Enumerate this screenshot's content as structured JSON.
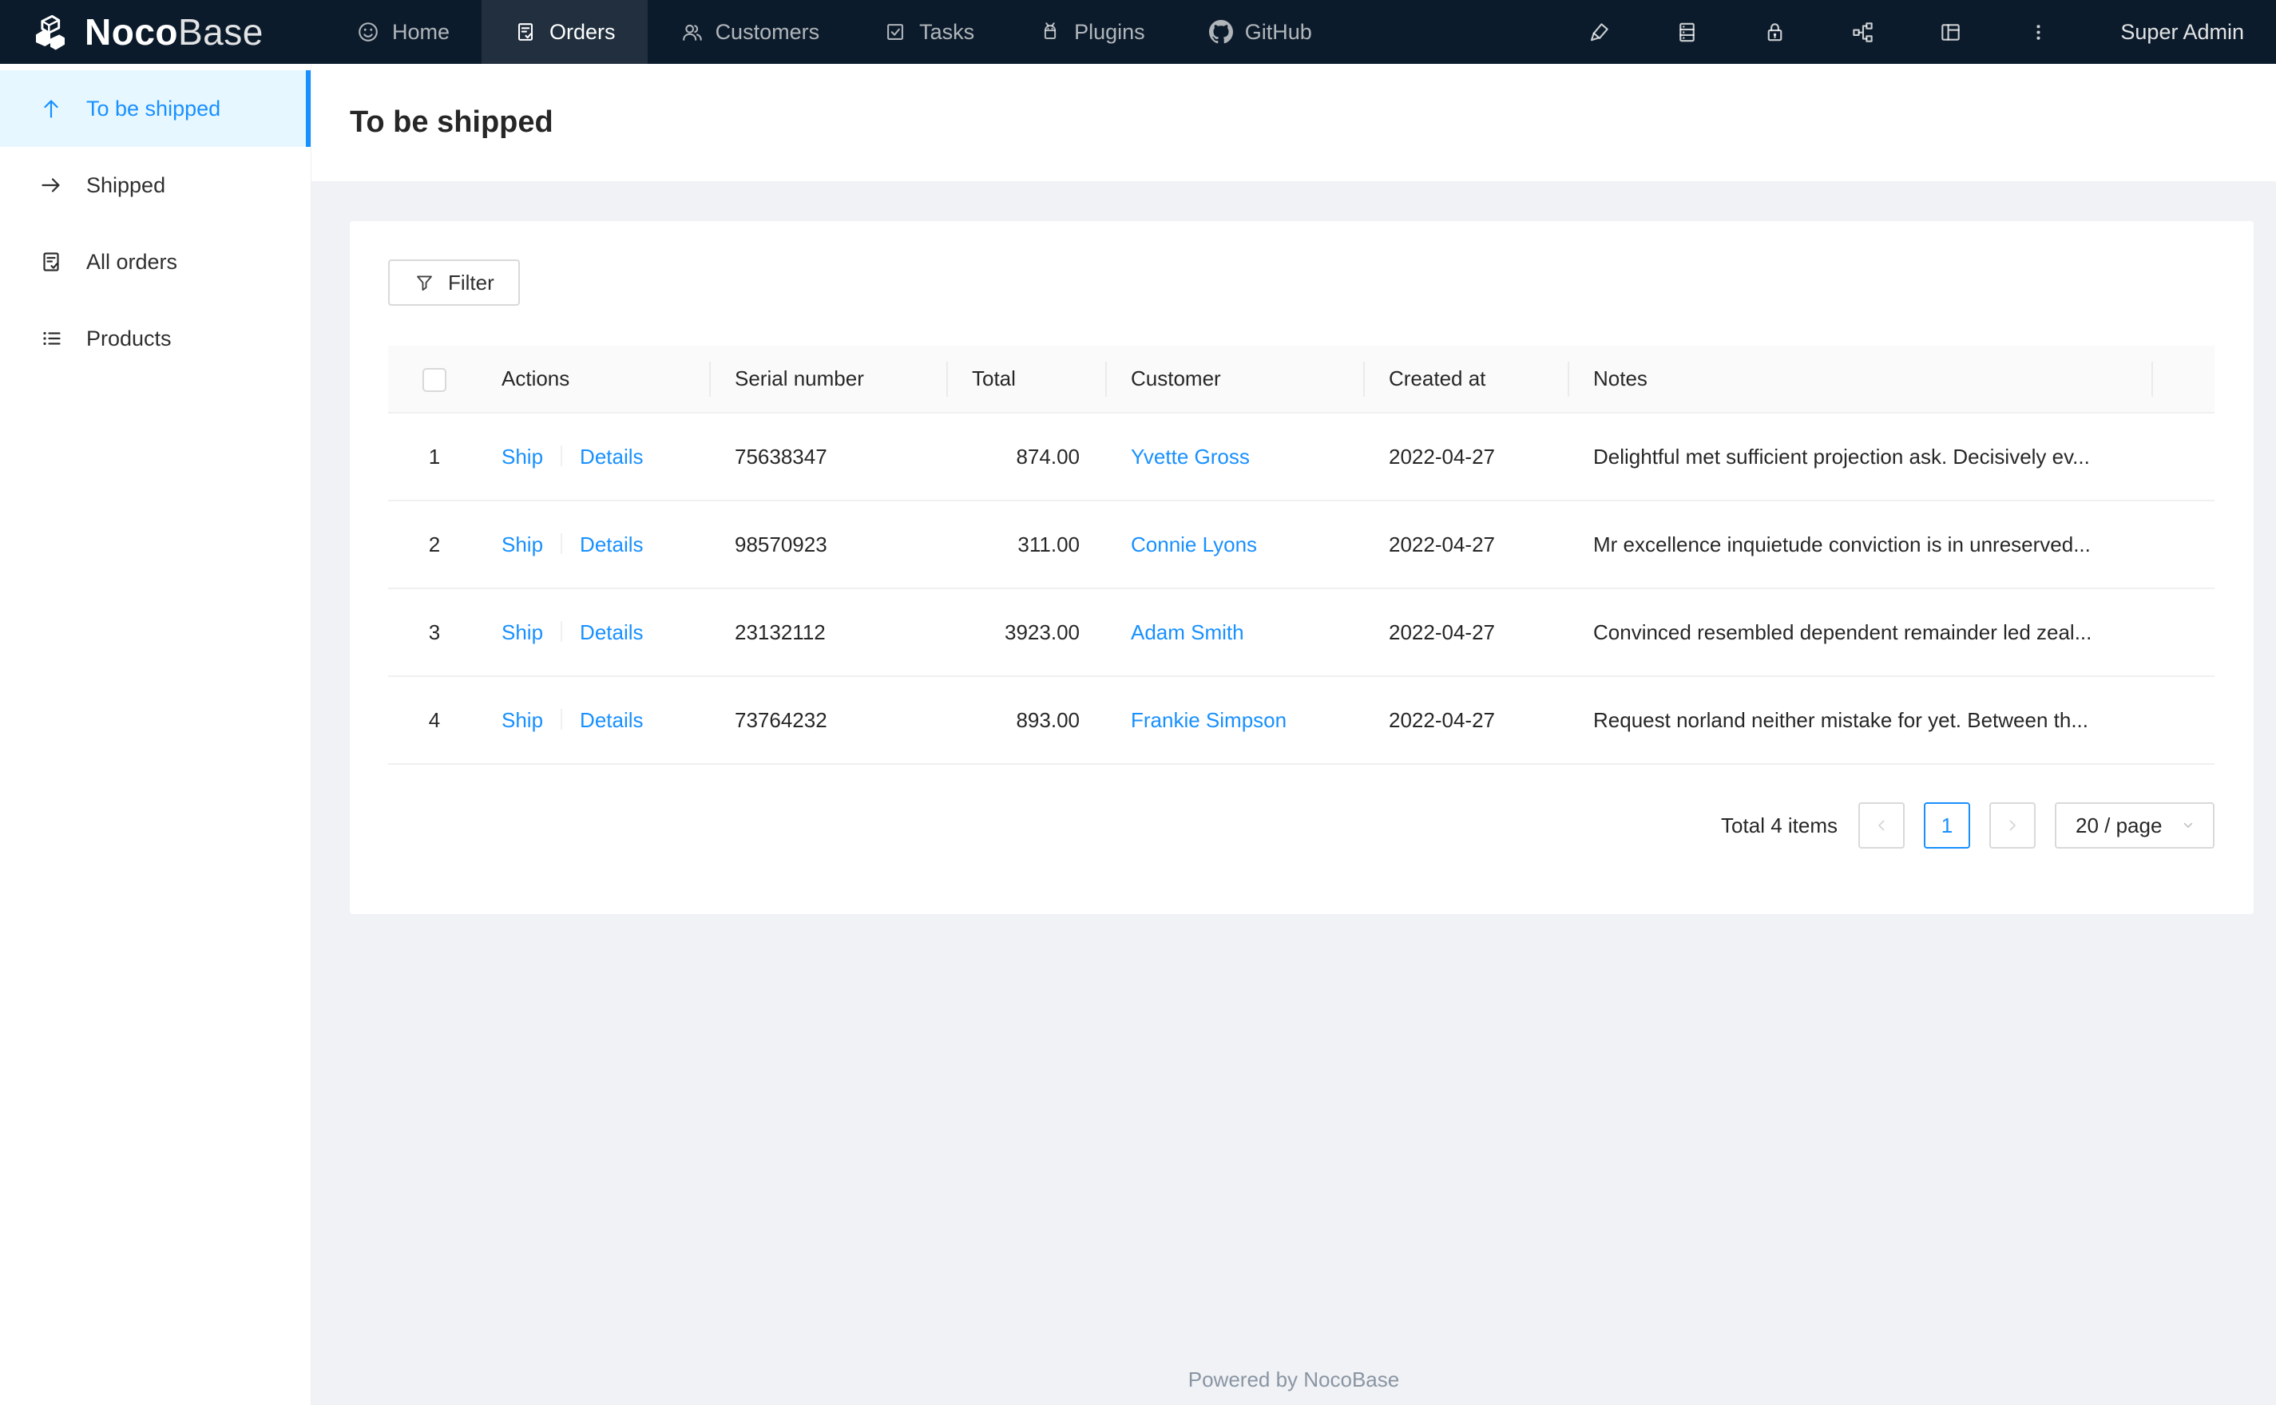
{
  "navbar": {
    "brand": {
      "prefix": "Noco",
      "suffix": "Base"
    },
    "items": [
      {
        "label": "Home",
        "icon": "smile-icon",
        "active": false
      },
      {
        "label": "Orders",
        "icon": "file-done-icon",
        "active": true
      },
      {
        "label": "Customers",
        "icon": "team-icon",
        "active": false
      },
      {
        "label": "Tasks",
        "icon": "check-square-icon",
        "active": false
      },
      {
        "label": "Plugins",
        "icon": "android-icon",
        "active": false
      },
      {
        "label": "GitHub",
        "icon": "github-icon",
        "active": false
      }
    ],
    "action_icons": [
      "highlight-icon",
      "database-icon",
      "lock-icon",
      "apartment-icon",
      "layout-icon",
      "more-icon"
    ],
    "user": "Super Admin"
  },
  "sidebar": {
    "items": [
      {
        "label": "To be shipped",
        "icon": "arrow-up-icon",
        "active": true
      },
      {
        "label": "Shipped",
        "icon": "arrow-right-icon",
        "active": false
      },
      {
        "label": "All orders",
        "icon": "file-done-icon",
        "active": false
      },
      {
        "label": "Products",
        "icon": "unordered-list-icon",
        "active": false
      }
    ]
  },
  "page": {
    "title": "To be shipped"
  },
  "toolbar": {
    "filter_label": "Filter"
  },
  "table": {
    "headers": [
      "",
      "Actions",
      "Serial number",
      "Total",
      "Customer",
      "Created at",
      "Notes"
    ],
    "rows": [
      {
        "index": "1",
        "ship": "Ship",
        "details": "Details",
        "serial": "75638347",
        "total": "874.00",
        "customer": "Yvette Gross",
        "created_at": "2022-04-27",
        "notes": "Delightful met sufficient projection ask. Decisively ev..."
      },
      {
        "index": "2",
        "ship": "Ship",
        "details": "Details",
        "serial": "98570923",
        "total": "311.00",
        "customer": "Connie Lyons",
        "created_at": "2022-04-27",
        "notes": "Mr excellence inquietude conviction is in unreserved..."
      },
      {
        "index": "3",
        "ship": "Ship",
        "details": "Details",
        "serial": "23132112",
        "total": "3923.00",
        "customer": "Adam Smith",
        "created_at": "2022-04-27",
        "notes": "Convinced resembled dependent remainder led zeal..."
      },
      {
        "index": "4",
        "ship": "Ship",
        "details": "Details",
        "serial": "73764232",
        "total": "893.00",
        "customer": "Frankie Simpson",
        "created_at": "2022-04-27",
        "notes": "Request norland neither mistake for yet. Between th..."
      }
    ]
  },
  "pagination": {
    "total_text": "Total 4 items",
    "current_page": "1",
    "page_size": "20 / page"
  },
  "footer": {
    "text": "Powered by NocoBase"
  },
  "colors": {
    "accent": "#1890ff",
    "navbar_bg": "#0c1b2b",
    "active_item_bg": "#e6f7ff",
    "page_bg": "#f0f2f5",
    "link": "#1890ff"
  }
}
